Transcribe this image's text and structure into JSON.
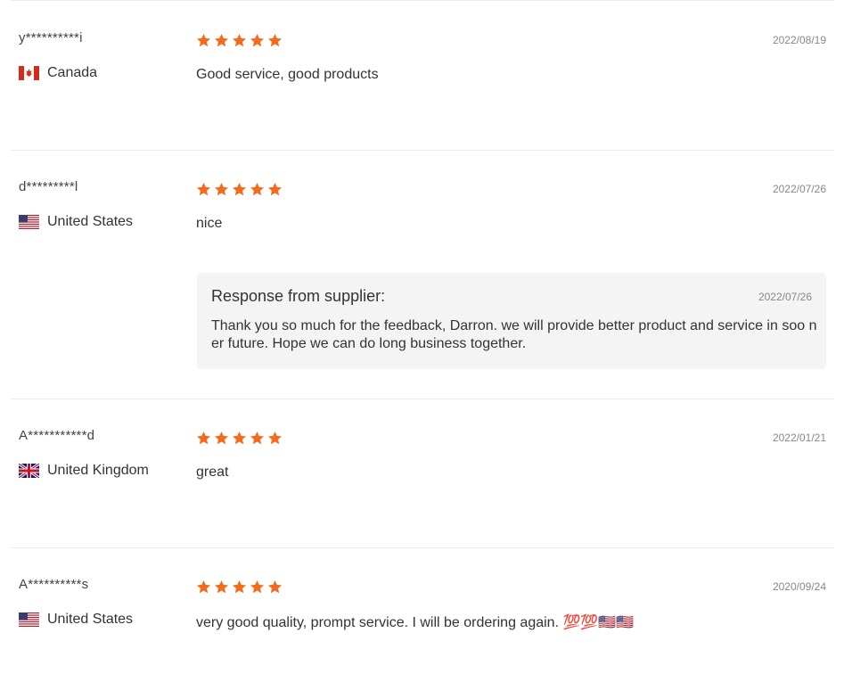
{
  "reviews": [
    {
      "username": "y**********i",
      "country": "Canada",
      "flag_icon": "canada-flag-icon",
      "rating": 5,
      "date": "2022/08/19",
      "comment": "Good service, good products"
    },
    {
      "username": "d*********l",
      "country": "United States",
      "flag_icon": "us-flag-icon",
      "rating": 5,
      "date": "2022/07/26",
      "comment": "nice",
      "response": {
        "title": "Response from supplier:",
        "date": "2022/07/26",
        "text": "Thank you so much for the feedback, Darron. we will provide better product and service in soo ner future. Hope we can do long business together."
      }
    },
    {
      "username": "A***********d",
      "country": "United Kingdom",
      "flag_icon": "uk-flag-icon",
      "rating": 5,
      "date": "2022/01/21",
      "comment": "great"
    },
    {
      "username": "A**********s",
      "country": "United States",
      "flag_icon": "us-flag-icon",
      "rating": 5,
      "date": "2020/09/24",
      "comment": "very good quality, prompt service. I will be ordering again. 💯💯🇺🇸🇺🇸"
    }
  ],
  "colors": {
    "star": "#f36b1c",
    "divider": "#ececec",
    "response_bg": "#f4f4f4"
  }
}
